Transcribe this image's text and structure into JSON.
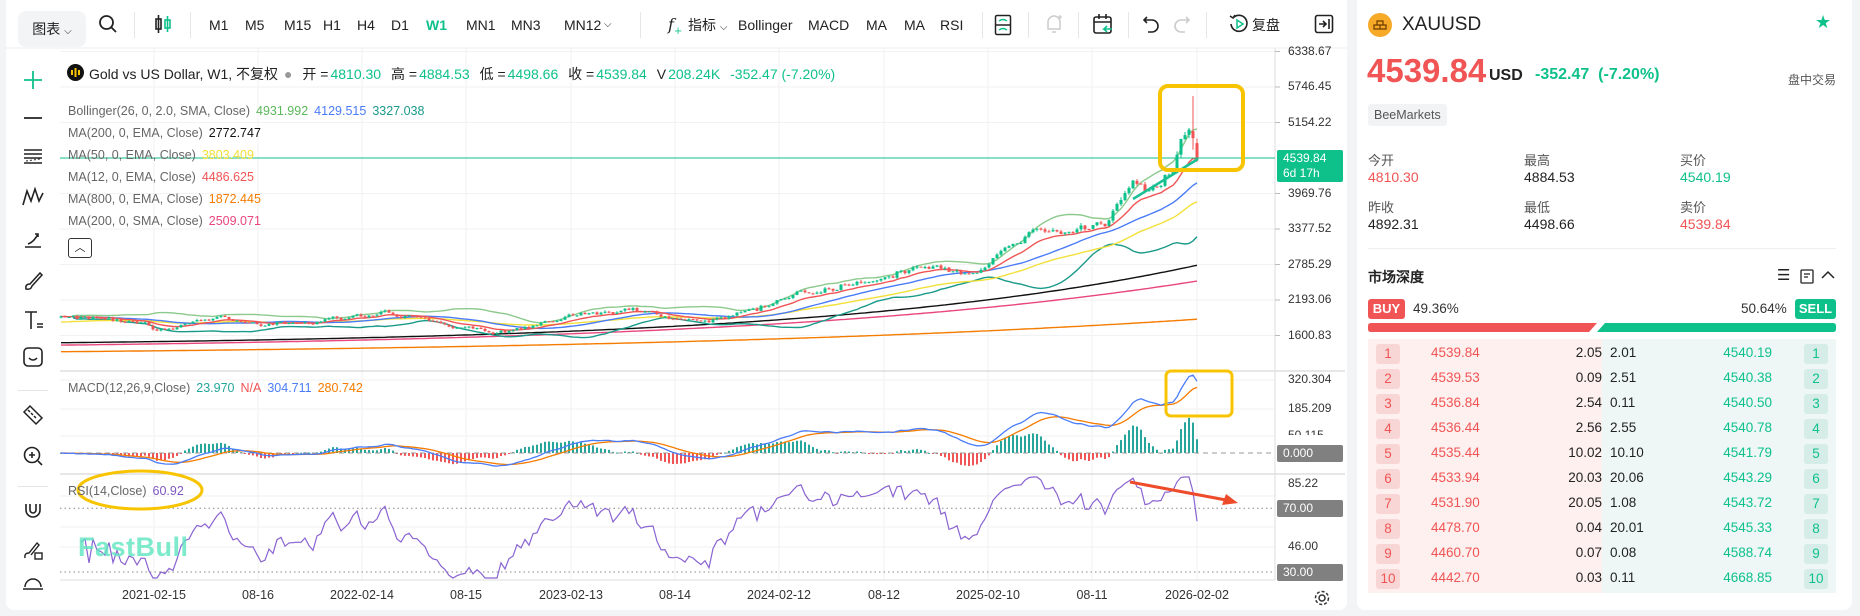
{
  "toolbar": {
    "chart_menu": "图表",
    "timeframes": [
      "M1",
      "M5",
      "M15",
      "H1",
      "H4",
      "D1",
      "W1",
      "MN1",
      "MN3",
      "MN12"
    ],
    "active_timeframe": "W1",
    "indicators_label": "指标",
    "quick_indicators": [
      "Bollinger",
      "MACD",
      "MA",
      "MA",
      "RSI"
    ],
    "replay_label": "复盘"
  },
  "legend": {
    "title": "Gold vs US Dollar, W1, 不复权",
    "open_label": "开 =",
    "open": "4810.30",
    "high_label": "高 =",
    "high": "4884.53",
    "low_label": "低 =",
    "low": "4498.66",
    "close_label": "收 =",
    "close": "4539.84",
    "volume_label": "V",
    "volume": "208.24K",
    "change": "-352.47 (-7.20%)",
    "indicators": [
      {
        "name": "Bollinger(26, 0, 2.0, SMA, Close)",
        "values": [
          "4931.992",
          "4129.515",
          "3327.038"
        ],
        "colors": [
          "#5cb85c",
          "#4a7cf7",
          "#1a9a8a"
        ]
      },
      {
        "name": "MA(200, 0, EMA, Close)",
        "values": [
          "2772.747"
        ],
        "colors": [
          "#111111"
        ]
      },
      {
        "name": "MA(50, 0, EMA, Close)",
        "values": [
          "3803.409"
        ],
        "colors": [
          "#f2e03a"
        ]
      },
      {
        "name": "MA(12, 0, EMA, Close)",
        "values": [
          "4486.625"
        ],
        "colors": [
          "#f05454"
        ]
      },
      {
        "name": "MA(800, 0, EMA, Close)",
        "values": [
          "1872.445"
        ],
        "colors": [
          "#f57c00"
        ]
      },
      {
        "name": "MA(200, 0, SMA, Close)",
        "values": [
          "2509.071"
        ],
        "colors": [
          "#e8467c"
        ]
      }
    ],
    "macd": {
      "name": "MACD(12,26,9,Close)",
      "histogram": "23.970",
      "na": "N/A",
      "macd": "304.711",
      "signal": "280.742"
    },
    "rsi": {
      "name": "RSI(14,Close)",
      "value": "60.92"
    }
  },
  "price_axis": [
    "6338.67",
    "5746.45",
    "5154.22",
    "3969.76",
    "3377.52",
    "2785.29",
    "2193.06",
    "1600.83"
  ],
  "price_tag": {
    "price": "4539.84",
    "countdown": "6d 17h"
  },
  "macd_axis": [
    "320.304",
    "185.209",
    "50.115",
    "0.000"
  ],
  "rsi_axis": [
    "85.22",
    "70.00",
    "46.00",
    "30.00"
  ],
  "date_axis": [
    "2021-02-15",
    "08-16",
    "2022-02-14",
    "08-15",
    "2023-02-13",
    "08-14",
    "2024-02-12",
    "08-12",
    "2025-02-10",
    "08-11",
    "2026-02-02"
  ],
  "watermark": "FastBull",
  "colors": {
    "up": "#0ec18b",
    "down": "#f05454",
    "annotation": "#f8c400",
    "arrow": "#ee4b2b"
  },
  "chart_data": {
    "type": "candlestick",
    "interval": "W1",
    "price_anchors": [
      [
        "2020-08-10",
        1950
      ],
      [
        "2020-11-09",
        1870
      ],
      [
        "2021-03-08",
        1700
      ],
      [
        "2021-06-01",
        1880
      ],
      [
        "2021-08-16",
        1760
      ],
      [
        "2021-11-15",
        1840
      ],
      [
        "2022-03-07",
        1980
      ],
      [
        "2022-09-26",
        1640
      ],
      [
        "2023-02-01",
        1930
      ],
      [
        "2023-05-01",
        2010
      ],
      [
        "2023-10-02",
        1840
      ],
      [
        "2023-12-25",
        2060
      ],
      [
        "2024-04-15",
        2380
      ],
      [
        "2024-10-28",
        2740
      ],
      [
        "2024-12-30",
        2620
      ],
      [
        "2025-04-21",
        3330
      ],
      [
        "2025-08-25",
        3400
      ],
      [
        "2025-10-13",
        4250
      ],
      [
        "2025-11-10",
        4050
      ],
      [
        "2025-12-22",
        4400
      ],
      [
        "2026-01-19",
        5000
      ]
    ],
    "prev_week": {
      "open": 5010,
      "high": 5595,
      "low": 4700,
      "close": 4892.31
    },
    "last_week": {
      "date": "2026-02-02",
      "open": 4810.3,
      "high": 4884.53,
      "low": 4498.66,
      "close": 4539.84
    },
    "price_range": [
      1300,
      6338.67
    ],
    "macd_range": [
      -120,
      340
    ],
    "rsi_range": [
      30,
      85.22
    ]
  },
  "symbol": {
    "ticker": "XAUUSD",
    "price": "4539.84",
    "currency": "USD",
    "change": "-352.47",
    "change_pct": "(-7.20%)",
    "session": "盘中交易",
    "broker": "BeeMarkets",
    "stats": [
      {
        "label": "今开",
        "value": "4810.30",
        "tone": "red"
      },
      {
        "label": "最高",
        "value": "4884.53",
        "tone": ""
      },
      {
        "label": "买价",
        "value": "4540.19",
        "tone": "grn"
      },
      {
        "label": "昨收",
        "value": "4892.31",
        "tone": ""
      },
      {
        "label": "最低",
        "value": "4498.66",
        "tone": ""
      },
      {
        "label": "卖价",
        "value": "4539.84",
        "tone": "red"
      }
    ]
  },
  "depth": {
    "title": "市场深度",
    "buy_label": "BUY",
    "buy_pct": "49.36%",
    "sell_label": "SELL",
    "sell_pct": "50.64%",
    "buy_share": 49.36,
    "rows": [
      [
        "1",
        "4539.84",
        "2.05",
        "2.01",
        "4540.19"
      ],
      [
        "2",
        "4539.53",
        "0.09",
        "2.51",
        "4540.38"
      ],
      [
        "3",
        "4536.84",
        "2.54",
        "0.11",
        "4540.50"
      ],
      [
        "4",
        "4536.44",
        "2.56",
        "2.55",
        "4540.78"
      ],
      [
        "5",
        "4535.44",
        "10.02",
        "10.10",
        "4541.79"
      ],
      [
        "6",
        "4533.94",
        "20.03",
        "20.06",
        "4543.29"
      ],
      [
        "7",
        "4531.90",
        "20.05",
        "1.08",
        "4543.72"
      ],
      [
        "8",
        "4478.70",
        "0.04",
        "20.01",
        "4545.33"
      ],
      [
        "9",
        "4460.70",
        "0.07",
        "0.08",
        "4588.74"
      ],
      [
        "10",
        "4442.70",
        "0.03",
        "0.11",
        "4668.85"
      ]
    ]
  }
}
